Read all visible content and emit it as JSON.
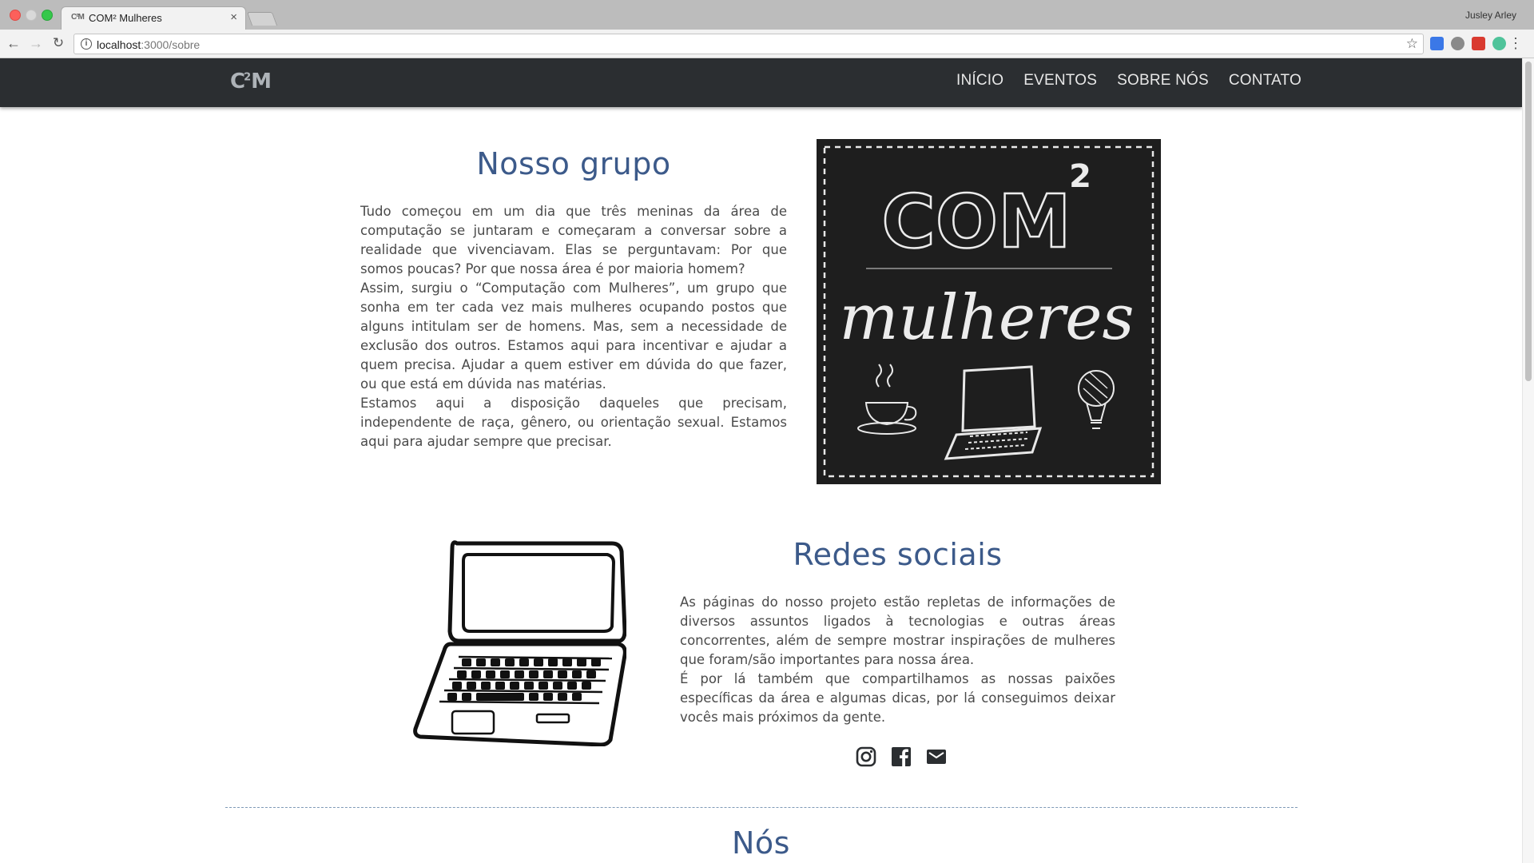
{
  "browser": {
    "tab_favicon": "C²M",
    "tab_title": "COM² Mulheres",
    "tab_close": "×",
    "profile": "Jusley Arley",
    "url_host": "localhost",
    "url_path": ":3000/sobre",
    "back_icon": "←",
    "forward_icon": "→",
    "reload_icon": "↻",
    "star_icon": "☆",
    "menu_icon": "⋮"
  },
  "site": {
    "logo": "C",
    "logo_sup": "2",
    "logo_tail": "M",
    "nav": [
      {
        "label": "INÍCIO"
      },
      {
        "label": "EVENTOS"
      },
      {
        "label": "SOBRE NÓS"
      },
      {
        "label": "CONTATO"
      }
    ]
  },
  "group": {
    "title": "Nosso grupo",
    "paragraphs": [
      "Tudo começou em um dia que três meninas da área de computação se juntaram e começaram a conversar sobre a realidade que vivenciavam. Elas se perguntavam: Por que somos poucas? Por que nossa área é por maioria homem?",
      "Assim, surgiu o “Computação com Mulheres”, um grupo que sonha em ter cada vez mais mulheres ocupando postos que alguns intitulam ser de homens. Mas, sem a necessidade de exclusão dos outros. Estamos aqui para incentivar e ajudar a quem precisa. Ajudar a quem estiver em dúvida do que fazer, ou que está em dúvida nas matérias.",
      "Estamos aqui a disposição daqueles que precisam, independente de raça, gênero, ou orientação sexual. Estamos aqui para ajudar sempre que precisar."
    ]
  },
  "board": {
    "word1": "COM",
    "sup": "2",
    "word2": "mulheres"
  },
  "social": {
    "title": "Redes sociais",
    "paragraphs": [
      "As páginas do nosso projeto estão repletas de informações de diversos assuntos ligados à tecnologias e outras áreas concorrentes, além de sempre mostrar inspirações de mulheres que foram/são importantes para nossa área.",
      "É por lá também que compartilhamos as nossas paixões específicas da área e algumas dicas, por lá conseguimos deixar vocês mais próximos da gente."
    ]
  },
  "nos": {
    "title": "Nós"
  },
  "colors": {
    "title_blue": "#3c5a8a",
    "nav_bg": "#2b2e31",
    "text": "#4a4a4a"
  }
}
